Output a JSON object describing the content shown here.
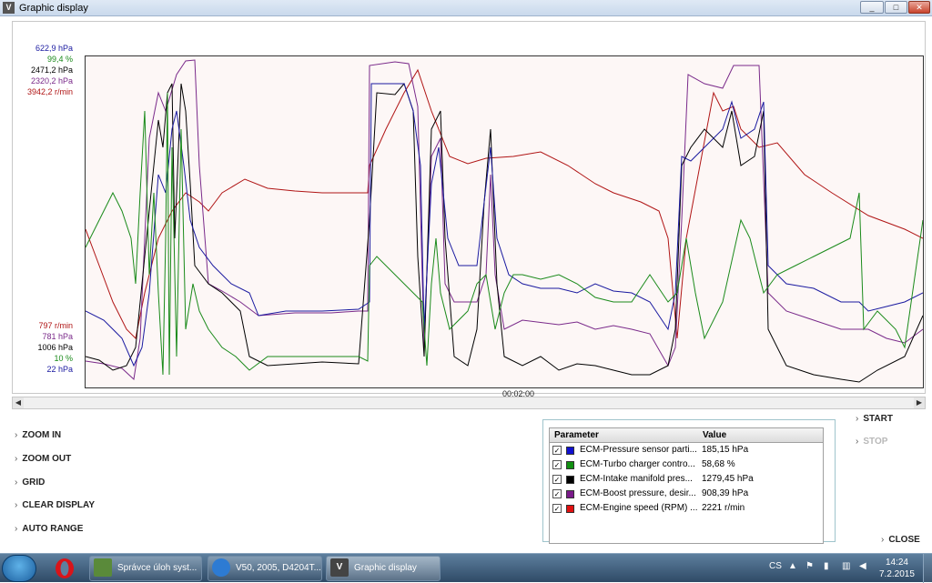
{
  "window": {
    "title": "Graphic display",
    "controls": {
      "minimize": "_",
      "maximize": "□",
      "close": "✕"
    }
  },
  "graph": {
    "axis_top": [
      {
        "text": "622,9 hPa",
        "color": "#1a1aa0"
      },
      {
        "text": "99,4 %",
        "color": "#1a8a1a"
      },
      {
        "text": "2471,2 hPa",
        "color": "#000000"
      },
      {
        "text": "2320,2 hPa",
        "color": "#7a2a8a"
      },
      {
        "text": "3942,2 r/min",
        "color": "#b01515"
      }
    ],
    "axis_bottom": [
      {
        "text": "797 r/min",
        "color": "#b01515"
      },
      {
        "text": "781 hPa",
        "color": "#7a2a8a"
      },
      {
        "text": "1006 hPa",
        "color": "#000000"
      },
      {
        "text": "10 %",
        "color": "#1a8a1a"
      },
      {
        "text": "22 hPa",
        "color": "#1a1aa0"
      }
    ],
    "time_label": "00:02:00"
  },
  "commands": {
    "zoom_in": "ZOOM IN",
    "zoom_out": "ZOOM OUT",
    "grid": "GRID",
    "clear_display": "CLEAR DISPLAY",
    "auto_range": "AUTO RANGE"
  },
  "param_table": {
    "header_param": "Parameter",
    "header_value": "Value",
    "rows": [
      {
        "name": "ECM-Pressure sensor parti...",
        "value": "185,15 hPa",
        "color": "#1010d0",
        "checked": "✓"
      },
      {
        "name": "ECM-Turbo charger contro...",
        "value": "58,68 %",
        "color": "#109010",
        "checked": "✓"
      },
      {
        "name": "ECM-Intake manifold pres...",
        "value": "1279,45 hPa",
        "color": "#000000",
        "checked": "✓"
      },
      {
        "name": "ECM-Boost pressure, desir...",
        "value": "908,39 hPa",
        "color": "#7a1a8a",
        "checked": "✓"
      },
      {
        "name": "ECM-Engine speed (RPM) ...",
        "value": "2221 r/min",
        "color": "#e01010",
        "checked": "✓"
      }
    ]
  },
  "right_commands": {
    "start": "START",
    "stop": "STOP",
    "close": "CLOSE"
  },
  "taskbar": {
    "tasks": [
      {
        "label": "Správce úloh syst..."
      },
      {
        "label": "V50, 2005, D4204T..."
      },
      {
        "label": "Graphic display"
      }
    ],
    "language": "CS",
    "time": "14:24",
    "date": "7.2.2015"
  },
  "colors": {
    "series_blue": "#1a1aa0",
    "series_green": "#1a8a1a",
    "series_black": "#000000",
    "series_purple": "#7a2a8a",
    "series_red": "#b01515"
  }
}
